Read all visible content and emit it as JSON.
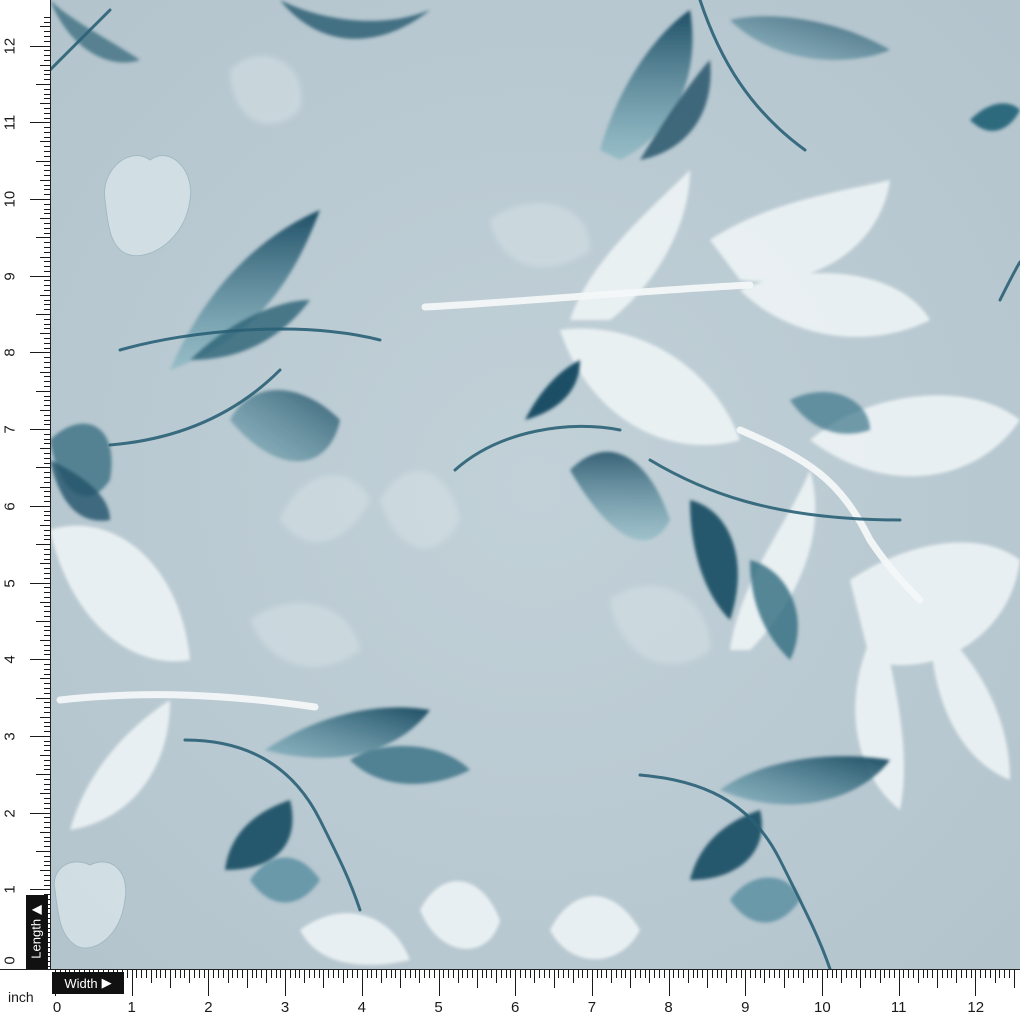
{
  "image": {
    "subject": "Digitally printed fabric swatch with watercolor-style teal and white leaves and bell flowers on a pale blue-grey background",
    "colors": {
      "background": "#b9c9d1",
      "teal_dark": "#24586f",
      "teal_mid": "#3f7f93",
      "white_leaf": "#eef4f6"
    }
  },
  "ruler": {
    "unit_label": "inch",
    "length_label": "Length",
    "width_label": "Width",
    "arrow_glyph": "▶",
    "vertical_numbers": [
      "0",
      "1",
      "2",
      "3",
      "4",
      "5",
      "6",
      "7",
      "8",
      "9",
      "10",
      "11",
      "12"
    ],
    "horizontal_numbers": [
      "0",
      "1",
      "2",
      "3",
      "4",
      "5",
      "6",
      "7",
      "8",
      "9",
      "10",
      "11",
      "12"
    ]
  }
}
